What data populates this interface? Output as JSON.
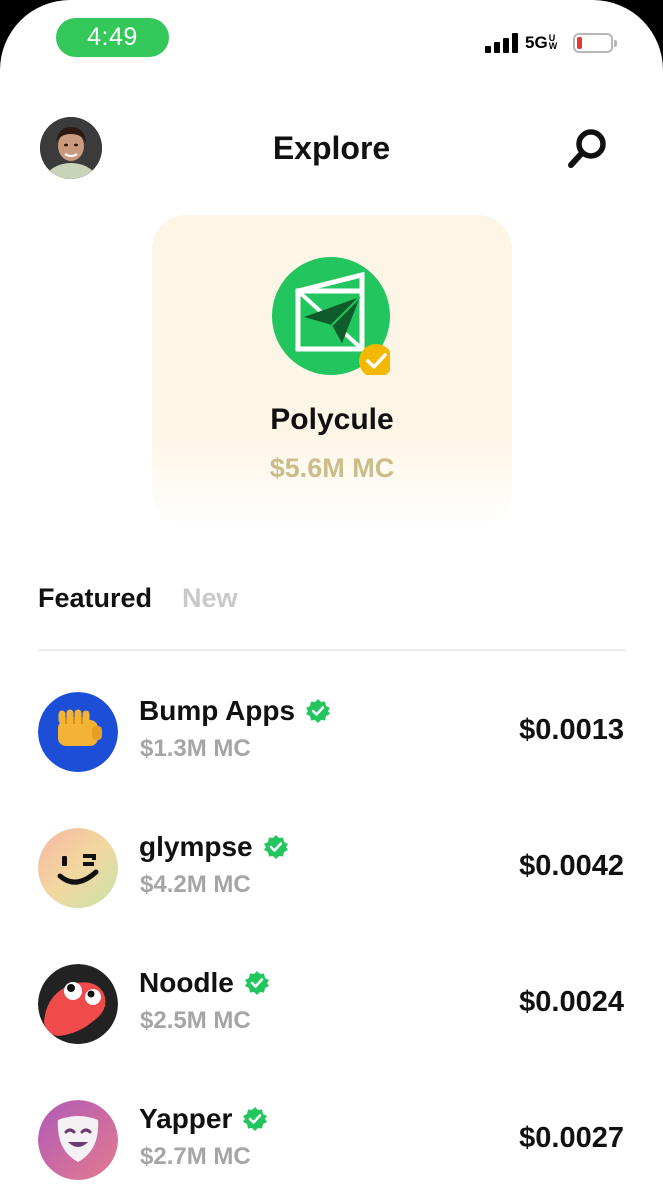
{
  "status_bar": {
    "time": "4:49",
    "network": "5G",
    "network_suffix_top": "U",
    "network_suffix_bottom": "W",
    "battery_level": 0.15,
    "colors": {
      "time_pill": "#34c759",
      "battery_low": "#e53935"
    }
  },
  "header": {
    "title": "Explore",
    "avatar_icon": "user-photo",
    "search_icon": "search-icon"
  },
  "hero": {
    "name": "Polycule",
    "market_cap": "$5.6M MC",
    "logo_icon": "paper-plane-cube-logo",
    "badge_icon": "gold-verified-badge",
    "colors": {
      "logo_bg": "#22c55e",
      "badge": "#f5b800",
      "card_bg": "#fdf6e6",
      "mc_text": "#cbbd8a"
    }
  },
  "tabs": [
    {
      "label": "Featured",
      "active": true
    },
    {
      "label": "New",
      "active": false
    }
  ],
  "tokens": [
    {
      "name": "Bump Apps",
      "market_cap": "$1.3M MC",
      "price": "$0.0013",
      "icon": "fist-bump-icon",
      "verified": true
    },
    {
      "name": "glympse",
      "market_cap": "$4.2M MC",
      "price": "$0.0042",
      "icon": "wink-face-icon",
      "verified": true
    },
    {
      "name": "Noodle",
      "market_cap": "$2.5M MC",
      "price": "$0.0024",
      "icon": "red-creature-icon",
      "verified": true
    },
    {
      "name": "Yapper",
      "market_cap": "$2.7M MC",
      "price": "$0.0027",
      "icon": "theater-mask-icon",
      "verified": true
    }
  ],
  "verified_color": "#22c55e"
}
